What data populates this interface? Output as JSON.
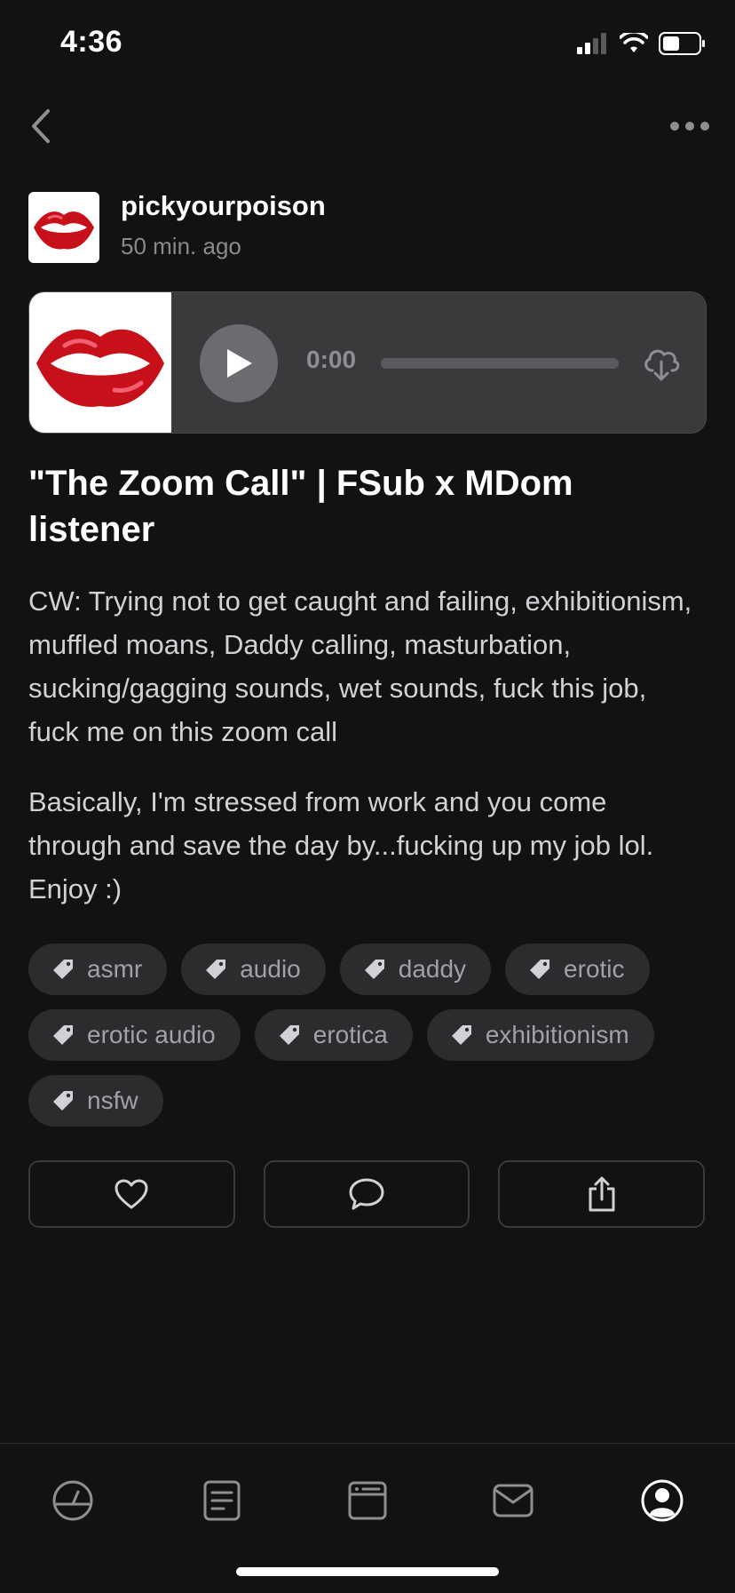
{
  "status": {
    "time": "4:36"
  },
  "author": {
    "name": "pickyourpoison",
    "time_ago": "50 min. ago"
  },
  "player": {
    "current_time": "0:00",
    "progress": 0
  },
  "post": {
    "title": "\"The Zoom Call\" | FSub x MDom listener",
    "paragraphs": [
      "CW: Trying not to get caught and failing, exhibitionism, muffled moans, Daddy calling, masturbation, sucking/gagging sounds, wet sounds, fuck this job, fuck me on this zoom call",
      "Basically, I'm stressed from work and you come through and save the day by...fucking up my job lol. Enjoy :)"
    ]
  },
  "tags": [
    "asmr",
    "audio",
    "daddy",
    "erotic",
    "erotic audio",
    "erotica",
    "exhibitionism",
    "nsfw"
  ],
  "actions": {
    "icons": [
      "heart-icon",
      "comment-icon",
      "share-icon"
    ]
  },
  "tabbar": {
    "icons": [
      "dashboard-icon",
      "posts-icon",
      "browser-icon",
      "mail-icon",
      "profile-icon"
    ],
    "active_index": 4
  },
  "colors": {
    "background": "#121212",
    "tag_bg": "#2c2c2e",
    "player_bg": "#3a3a3c",
    "muted_text": "#8a8a8e"
  }
}
